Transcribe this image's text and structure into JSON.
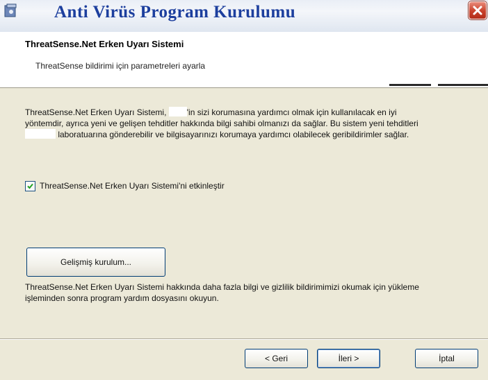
{
  "window": {
    "title": "Anti Virüs Program Kurulumu"
  },
  "header": {
    "title": "ThreatSense.Net Erken Uyarı Sistemi",
    "subtitle": "ThreatSense bildirimi için parametreleri ayarla"
  },
  "body": {
    "desc_part1": "ThreatSense.Net Erken Uyarı Sistemi, ",
    "desc_part2": "'in sizi korumasına yardımcı olmak için kullanılacak en iyi yöntemdir, ayrıca yeni ve gelişen tehditler hakkında bilgi sahibi olmanızı da sağlar. Bu sistem yeni tehditleri ",
    "desc_part3": " laboratuarına gönderebilir ve bilgisayarınızı korumaya yardımcı olabilecek geribildirimler sağlar.",
    "checkbox_label": "ThreatSense.Net Erken Uyarı Sistemi'ni etkinleştir",
    "checkbox_checked": true,
    "advanced_label": "Gelişmiş kurulum...",
    "info_text": "ThreatSense.Net Erken Uyarı Sistemi hakkında daha fazla bilgi ve gizlilik bildirimimizi okumak için yükleme işleminden sonra program yardım dosyasını okuyun."
  },
  "footer": {
    "back_label": "< Geri",
    "next_label": "İleri >",
    "cancel_label": "İptal"
  },
  "colors": {
    "title": "#1d3f9e",
    "close": "#c8402a",
    "dialog_bg": "#ece9d8",
    "button_border": "#003c74"
  }
}
